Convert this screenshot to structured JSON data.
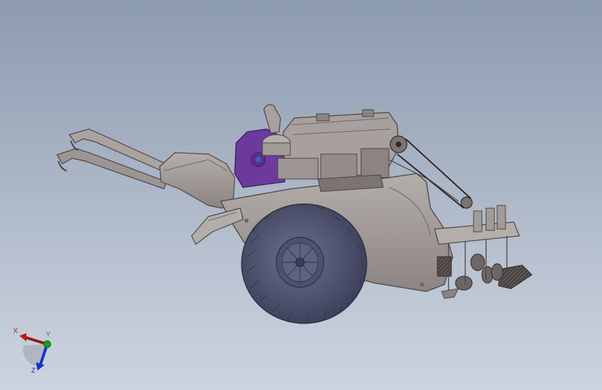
{
  "viewport": {
    "background_top": "#8d9bb0",
    "background_bottom": "#ccd4df"
  },
  "model": {
    "parts": [
      "handlebars",
      "fender",
      "engine",
      "exhaust-pipe",
      "flywheel-cover",
      "drive-belt",
      "chassis",
      "drive-wheel",
      "seeder-unit",
      "hopper-tray"
    ],
    "colors": {
      "body": "#a39b98",
      "body_dark": "#6e6664",
      "tire": "#5a5e7a",
      "tire_dark": "#3b3e57",
      "flywheel": "#6b3a9c",
      "accent_blue": "#3a5fc8"
    }
  },
  "triad": {
    "x_label": "X",
    "y_label": "Y",
    "z_label": "Z",
    "x_color": "#c01818",
    "y_color": "#18a018",
    "z_color": "#1830c0"
  }
}
